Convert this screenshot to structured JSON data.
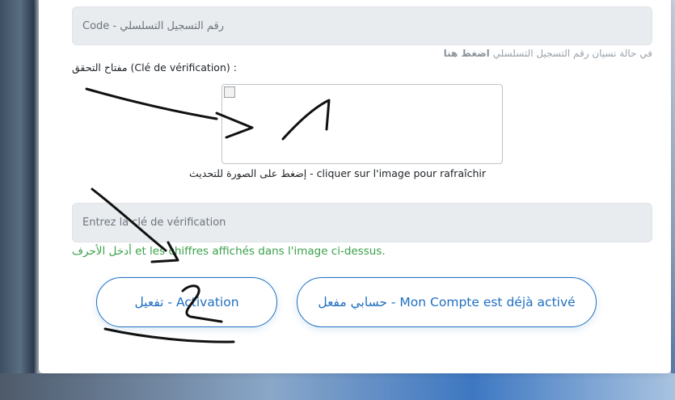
{
  "form": {
    "code_placeholder": "Code - رقم التسجيل التسلسلي",
    "forgot_hint_text": "في حالة نسيان رقم التسجيل التسلسلي",
    "forgot_hint_link": "اضغط هنا",
    "key_label": "مفتاح التحقق (Clé de vérification) :",
    "captcha_caption": "إضغط على الصورة للتحديث - cliquer sur l'image pour rafraîchir",
    "key_placeholder": "Entrez la clé de vérification",
    "key_hint": "أدخل الأحرف et les chiffres affichés dans l'image ci-dessus.",
    "activate_label": "تفعيل - Activation",
    "already_label": "حسابي مفعل - Mon Compte est déjà activé"
  },
  "colors": {
    "accent": "#1f6fc0",
    "hint_green": "#3aa14a",
    "input_bg": "#e9ecef"
  },
  "icons": {
    "captcha_image": "broken-image-icon"
  }
}
